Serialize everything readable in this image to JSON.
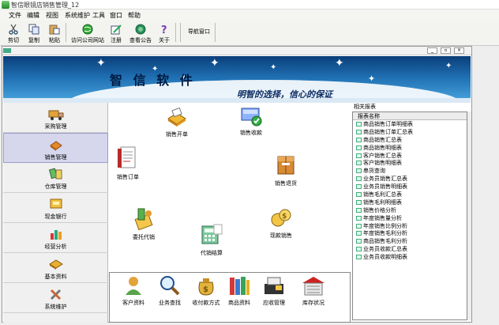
{
  "window": {
    "title": "智信眼镜店销售管理_12"
  },
  "menu": [
    "文件",
    "编辑",
    "视图",
    "系统维护",
    "工具",
    "窗口",
    "帮助"
  ],
  "toolbar": [
    {
      "label": "剪切",
      "icon": "scissors-icon"
    },
    {
      "label": "复制",
      "icon": "copy-icon"
    },
    {
      "label": "粘贴",
      "icon": "paste-icon"
    },
    {
      "label": "访问公司网站",
      "icon": "globe-icon"
    },
    {
      "label": "注册",
      "icon": "register-icon"
    },
    {
      "label": "查看公告",
      "icon": "notice-icon"
    },
    {
      "label": "关于",
      "icon": "help-icon"
    },
    {
      "label": "导航窗口",
      "icon": "navigation-icon"
    }
  ],
  "banner": {
    "title": "智 信 软 件",
    "slogan": "明智的选择，信心的保证"
  },
  "sidebar": [
    {
      "label": "采购管理",
      "icon": "truck-icon"
    },
    {
      "label": "销售管理",
      "icon": "sales-icon"
    },
    {
      "label": "仓库管理",
      "icon": "warehouse-icon"
    },
    {
      "label": "现金银行",
      "icon": "cash-icon"
    },
    {
      "label": "经营分析",
      "icon": "analysis-icon"
    },
    {
      "label": "基本资料",
      "icon": "basic-data-icon"
    },
    {
      "label": "系统维护",
      "icon": "tools-icon"
    }
  ],
  "main_items": {
    "sales_billing": "销售开单",
    "sales_receipt": "销售收款",
    "sales_order": "销售订单",
    "sales_return": "销售退货",
    "consignment": "委托代销",
    "consign_settle": "代销结算",
    "cash_sales": "现款销售"
  },
  "bottom_items": [
    "客户资料",
    "业务查找",
    "收付款方式",
    "商品资料",
    "应收管理",
    "库存状况"
  ],
  "reports": {
    "title": "相关报表",
    "header": "报表名称",
    "items": [
      "商品销售订单明细表",
      "商品销售订单汇总表",
      "商品销售汇总表",
      "商品销售明细表",
      "客户销售汇总表",
      "客户销售明细表",
      "串货查询",
      "业务员销售汇总表",
      "业务员销售明细表",
      "销售毛利汇总表",
      "销售毛利明细表",
      "销售价格分析",
      "年度销售量分析",
      "年度销售比例分析",
      "年度销售毛利分析",
      "商品销售毛利分析",
      "业务员收款汇总表",
      "业务员收款明细表"
    ]
  }
}
